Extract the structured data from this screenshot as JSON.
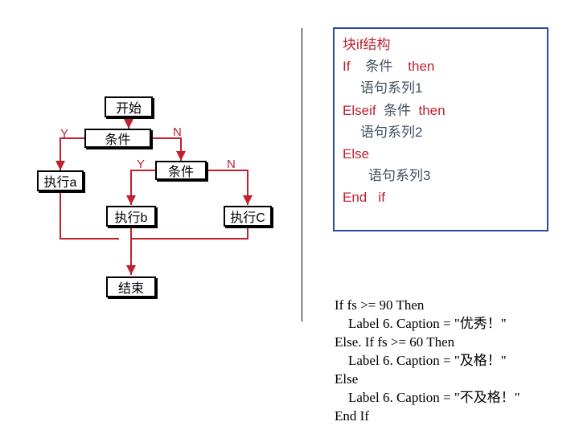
{
  "syntax": {
    "title": "块if结构",
    "if": "If",
    "cond": "条件",
    "then": "then",
    "stmt1": "语句系列1",
    "elseif": "Elseif",
    "stmt2": "语句系列2",
    "else": "Else",
    "stmt3": "语句系列3",
    "endif_end": "End",
    "endif_if": "if"
  },
  "flow": {
    "start": "开始",
    "cond1": "条件",
    "cond2": "条件",
    "y1": "Y",
    "n1": "N",
    "y2": "Y",
    "n2": "N",
    "execA": "执行a",
    "execB": "执行b",
    "execC": "执行C",
    "end": "结束"
  },
  "code": {
    "l1": "If fs >= 90 Then",
    "l2": "    Label 6. Caption = \"优秀！\"",
    "l3": "Else. If fs >= 60 Then",
    "l4": "    Label 6. Caption = \"及格！\"",
    "l5": "Else",
    "l6": "    Label 6. Caption = \"不及格！\"",
    "l7": "End If"
  }
}
